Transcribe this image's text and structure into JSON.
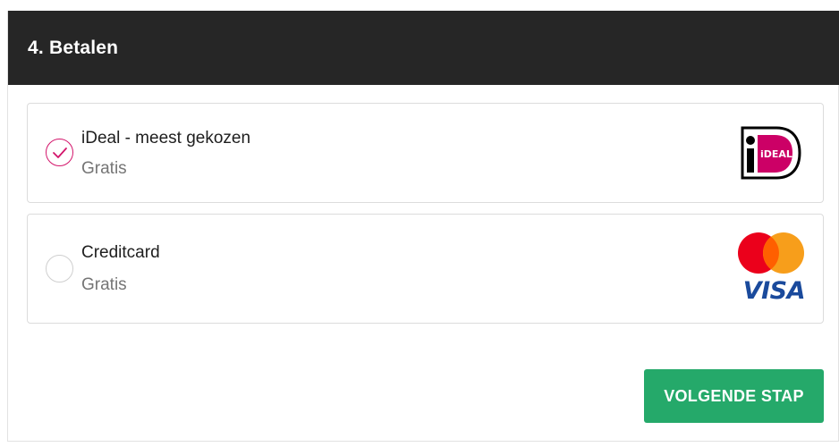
{
  "section": {
    "title": "4. Betalen"
  },
  "payment_options": [
    {
      "name": "iDeal - meest gekozen",
      "price": "Gratis",
      "selected": true,
      "logo": "ideal-logo",
      "logo_text": "iDEAL"
    },
    {
      "name": "Creditcard",
      "price": "Gratis",
      "selected": false,
      "logos": [
        "mastercard-logo",
        "visa-logo"
      ],
      "visa_text": "VISA"
    }
  ],
  "actions": {
    "next_label": "VOLGENDE STAP"
  },
  "colors": {
    "header_bg": "#262626",
    "accent_pink": "#d3156b",
    "button_green": "#25a96a",
    "mastercard_red": "#eb001b",
    "mastercard_orange": "#f79e1b",
    "visa_blue": "#1a4a9c"
  }
}
